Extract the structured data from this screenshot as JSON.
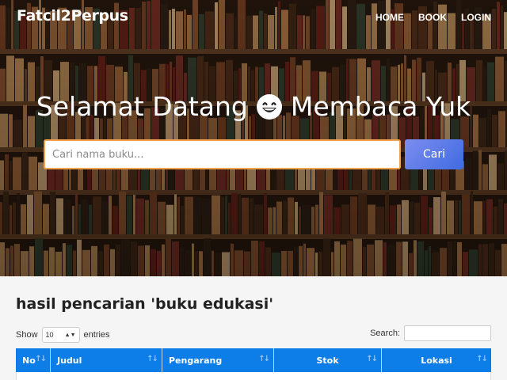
{
  "navbar": {
    "brand": "Fatcil2Perpus",
    "links": [
      "HOME",
      "BOOK",
      "LOGIN"
    ]
  },
  "hero": {
    "welcome_before": "Selamat Datang",
    "welcome_after": "Membaca Yuk",
    "emoji": "grinning-face",
    "search_placeholder": "Cari nama buku...",
    "search_button": "Cari"
  },
  "results": {
    "title": "hasil pencarian 'buku edukasi'",
    "show_label": "Show",
    "entries_value": "10",
    "entries_label": "entries",
    "search_label": "Search:",
    "columns": [
      "No",
      "Judul",
      "Pengarang",
      "Stok",
      "Lokasi"
    ]
  },
  "colors": {
    "table_header": "#0d7de8",
    "search_border": "#f0a24a",
    "button_gradient_start": "#7d8df0",
    "button_gradient_end": "#3f6be0"
  }
}
